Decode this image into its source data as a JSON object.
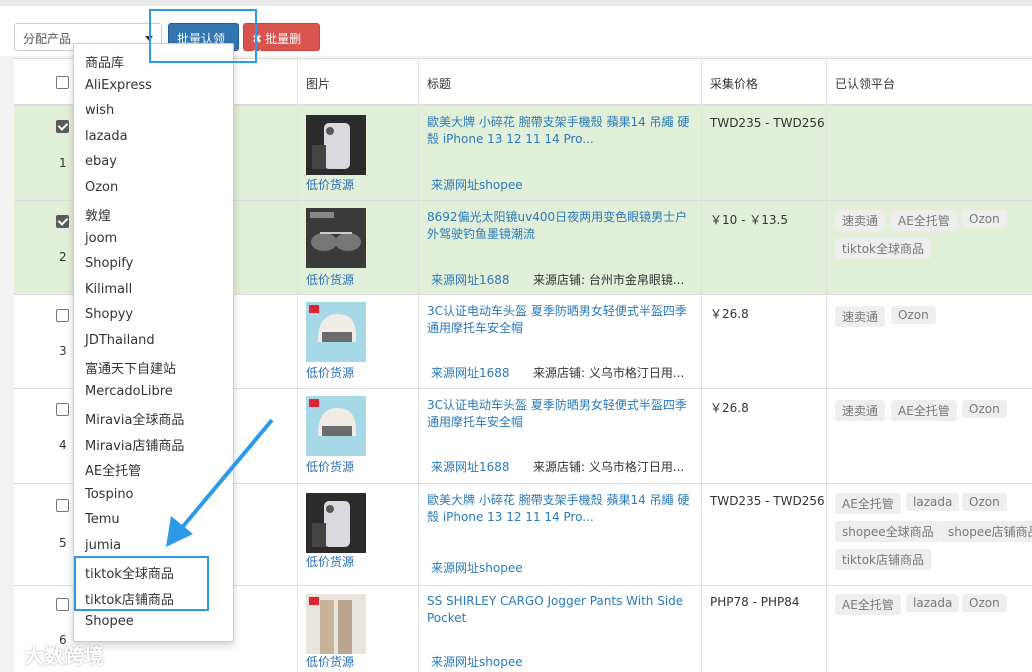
{
  "toolbar": {
    "select_value": "分配产品",
    "claim_label": "批量认领",
    "delete_label": "批量删除"
  },
  "table": {
    "headers": [
      "图片",
      "标题",
      "采集价格",
      "已认领平台"
    ],
    "rows": [
      {
        "num": "1",
        "checked": true,
        "title": "歐美大牌 小碎花 腕帶支架手機殼 蘋果14 吊繩 硬殼 iPhone 13 12 11 14 Pro...",
        "low_price": "低价货源",
        "source": "来源网址shopee",
        "shop": "",
        "price": "TWD235 - TWD256",
        "tags": []
      },
      {
        "num": "2",
        "checked": true,
        "title": "8692偏光太阳镜uv400日夜两用变色眼镜男士户外驾驶钓鱼墨镜潮流",
        "low_price": "低价货源",
        "source": "来源网址1688",
        "shop": "来源店铺: 台州市金帛眼镜...",
        "price": "￥10 - ￥13.5",
        "tags": [
          "速卖通",
          "AE全托管",
          "Ozon",
          "tiktok全球商品"
        ]
      },
      {
        "num": "3",
        "checked": false,
        "title": "3C认证电动车头盔 夏季防晒男女轻便式半盔四季通用摩托车安全帽",
        "low_price": "低价货源",
        "source": "来源网址1688",
        "shop": "来源店铺: 义乌市格汀日用...",
        "price": "￥26.8",
        "tags": [
          "速卖通",
          "Ozon"
        ]
      },
      {
        "num": "4",
        "checked": false,
        "title": "3C认证电动车头盔 夏季防晒男女轻便式半盔四季通用摩托车安全帽",
        "low_price": "低价货源",
        "source": "来源网址1688",
        "shop": "来源店铺: 义乌市格汀日用...",
        "price": "￥26.8",
        "tags": [
          "速卖通",
          "AE全托管",
          "Ozon"
        ]
      },
      {
        "num": "5",
        "checked": false,
        "title": "歐美大牌 小碎花 腕帶支架手機殼 蘋果14 吊繩 硬殼 iPhone 13 12 11 14 Pro...",
        "low_price": "低价货源",
        "source": "来源网址shopee",
        "shop": "",
        "price": "TWD235 - TWD256",
        "tags": [
          "AE全托管",
          "lazada",
          "Ozon",
          "shopee全球商品",
          "shopee店铺商品",
          "tiktok店铺商品"
        ]
      },
      {
        "num": "6",
        "checked": false,
        "title": "SS SHIRLEY CARGO Jogger Pants With Side Pocket",
        "low_price": "低价货源",
        "source": "来源网址shopee",
        "shop": "",
        "price": "PHP78 - PHP84",
        "tags": [
          "AE全托管",
          "lazada",
          "Ozon"
        ]
      }
    ]
  },
  "dropdown": {
    "items": [
      "商品库",
      "AliExpress",
      "wish",
      "lazada",
      "ebay",
      "Ozon",
      "敦煌",
      "joom",
      "Shopify",
      "Kilimall",
      "Shopyy",
      "JDThailand",
      "富通天下自建站",
      "MercadoLibre",
      "Miravia全球商品",
      "Miravia店铺商品",
      "AE全托管",
      "Tospino",
      "Temu",
      "jumia",
      "tiktok全球商品",
      "tiktok店铺商品",
      "Shopee"
    ]
  },
  "watermark": "大数跨境",
  "colors": {
    "selected_row": "#e2efd9",
    "primary": "#3276b1",
    "danger": "#d9534f",
    "highlight": "#2d9ae6"
  }
}
